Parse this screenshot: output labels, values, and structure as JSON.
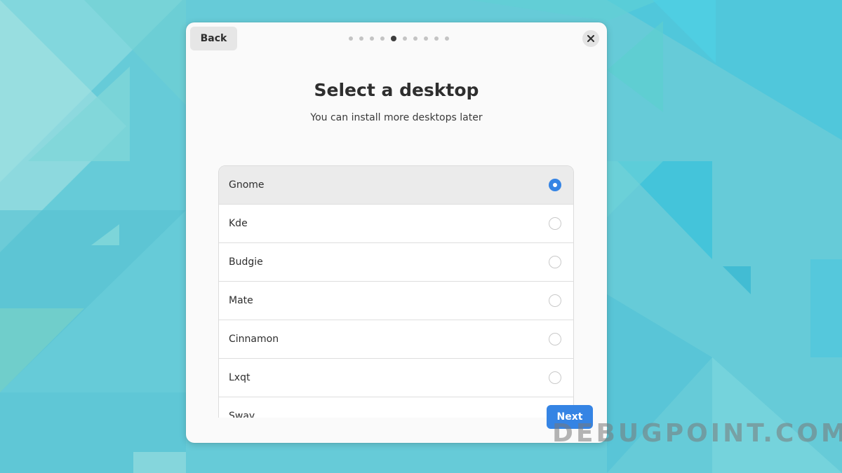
{
  "dialog": {
    "back_label": "Back",
    "pager": {
      "total": 10,
      "current": 5
    },
    "title": "Select a desktop",
    "subtitle": "You can install more desktops later",
    "desktops": [
      {
        "label": "Gnome",
        "selected": true
      },
      {
        "label": "Kde",
        "selected": false
      },
      {
        "label": "Budgie",
        "selected": false
      },
      {
        "label": "Mate",
        "selected": false
      },
      {
        "label": "Cinnamon",
        "selected": false
      },
      {
        "label": "Lxqt",
        "selected": false
      },
      {
        "label": "Sway",
        "selected": false
      }
    ],
    "next_label": "Next",
    "close_icon": "close-icon"
  },
  "watermark": "DEBUGPOINT.COM",
  "colors": {
    "accent": "#3584e4",
    "wallpaper": "#5cc8d6"
  }
}
